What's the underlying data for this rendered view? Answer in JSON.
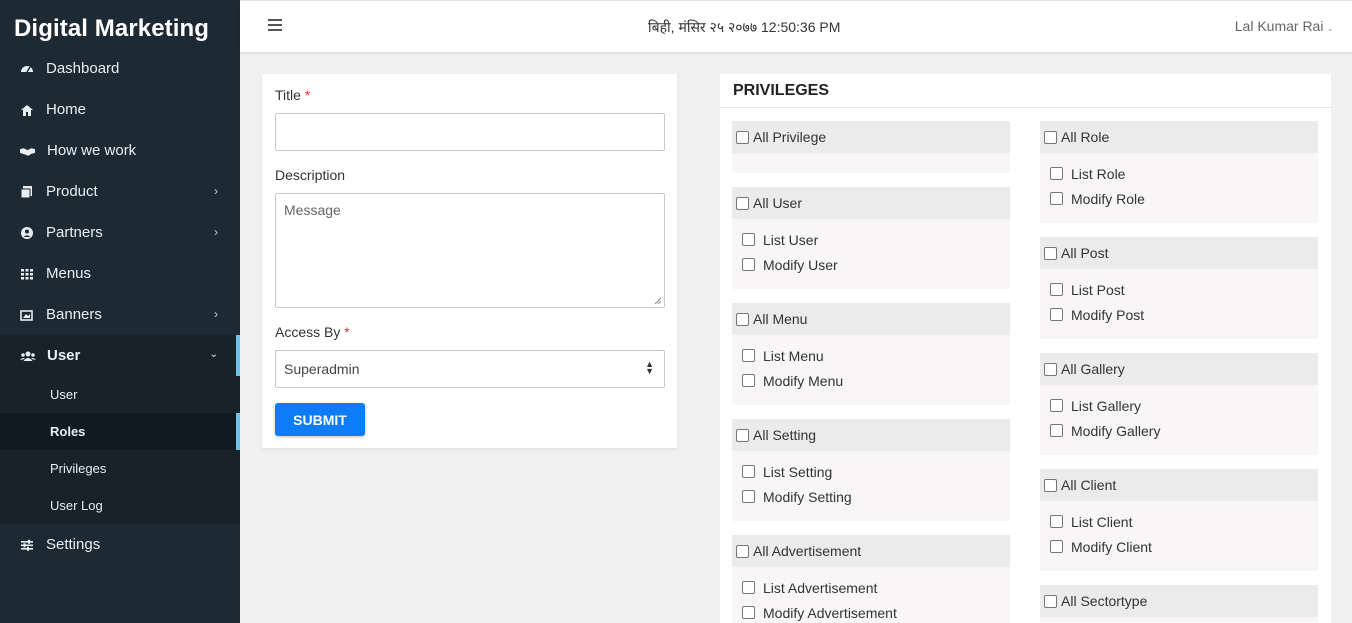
{
  "brand": "Digital Marketing",
  "sidebar": {
    "items": [
      {
        "label": "Dashboard",
        "icon": "dashboard-icon"
      },
      {
        "label": "Home",
        "icon": "home-icon"
      },
      {
        "label": "How we work",
        "icon": "handshake-icon"
      },
      {
        "label": "Product",
        "icon": "product-icon"
      },
      {
        "label": "Partners",
        "icon": "partners-icon"
      },
      {
        "label": "Menus",
        "icon": "menus-icon"
      },
      {
        "label": "Banners",
        "icon": "banners-icon"
      },
      {
        "label": "User",
        "icon": "users-icon"
      },
      {
        "label": "Settings",
        "icon": "settings-icon"
      }
    ],
    "sub_items": [
      "User",
      "Roles",
      "Privileges",
      "User Log"
    ]
  },
  "topbar": {
    "datetime": "बिही, मंसिर २५ २०७७ 12:50:36 PM",
    "username": "Lal Kumar Rai"
  },
  "form": {
    "title_label": "Title",
    "description_label": "Description",
    "description_placeholder": "Message",
    "access_label": "Access By",
    "access_value": "Superadmin",
    "required_mark": "*",
    "submit_label": "SUBMIT"
  },
  "privileges": {
    "title": "PRIVILEGES",
    "left": [
      {
        "all": "All Privilege",
        "perms": []
      },
      {
        "all": "All User",
        "perms": [
          "List User",
          "Modify User"
        ]
      },
      {
        "all": "All Menu",
        "perms": [
          "List Menu",
          "Modify Menu"
        ]
      },
      {
        "all": "All Setting",
        "perms": [
          "List Setting",
          "Modify Setting"
        ]
      },
      {
        "all": "All Advertisement",
        "perms": [
          "List Advertisement",
          "Modify Advertisement"
        ]
      }
    ],
    "right": [
      {
        "all": "All Role",
        "perms": [
          "List Role",
          "Modify Role"
        ]
      },
      {
        "all": "All Post",
        "perms": [
          "List Post",
          "Modify Post"
        ]
      },
      {
        "all": "All Gallery",
        "perms": [
          "List Gallery",
          "Modify Gallery"
        ]
      },
      {
        "all": "All Client",
        "perms": [
          "List Client",
          "Modify Client"
        ]
      },
      {
        "all": "All Sectortype",
        "perms": []
      }
    ]
  },
  "colors": {
    "sidebar_bg": "#1e2a33",
    "active_indicator": "#6fc3e8",
    "submit_bg": "#0d7df7",
    "required": "#dd3333"
  }
}
